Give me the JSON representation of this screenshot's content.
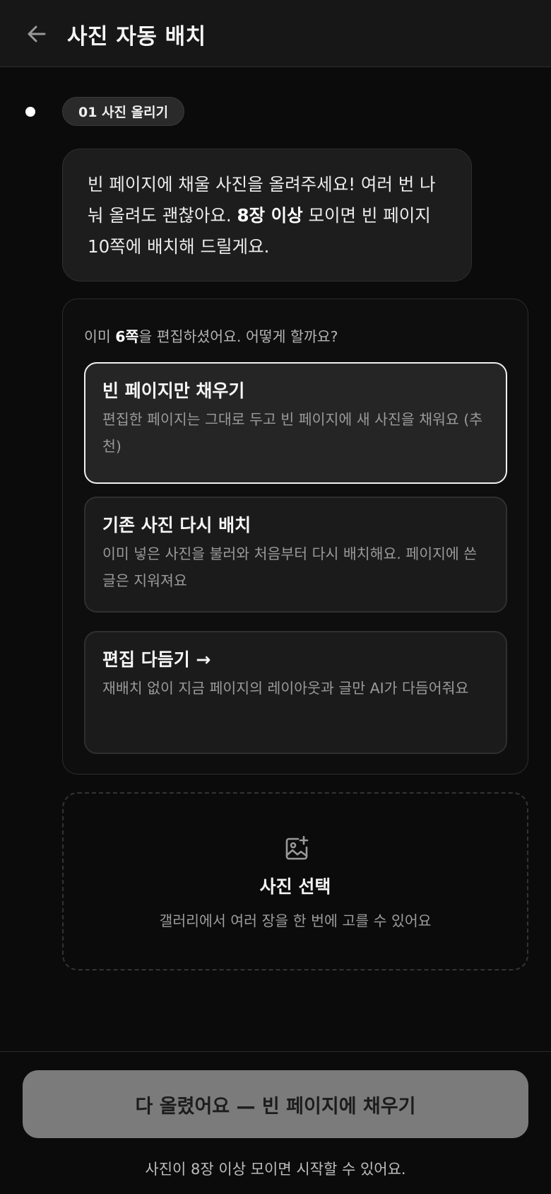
{
  "header": {
    "back_icon": "arrow-left-icon",
    "title": "사진 자동 배치"
  },
  "step": {
    "label": "01 사진 올리기"
  },
  "message": {
    "part1": "빈 페이지에 채울 사진을 올려주세요! 여러 번 나눠 올려도 괜찮아요. ",
    "bold": "8장 이상",
    "part2": " 모이면 빈 페이지 10쪽에 배치해 드릴게요."
  },
  "choice": {
    "question_prefix": "이미 ",
    "question_bold": "6쪽",
    "question_suffix": "을 편집하셨어요. 어떻게 할까요?",
    "options": [
      {
        "title": "빈 페이지만 채우기",
        "description": "편집한 페이지는 그대로 두고 빈 페이지에 새 사진을 채워요 (추천)",
        "selected": true
      },
      {
        "title": "기존 사진 다시 배치",
        "description": "이미 넣은 사진을 불러와 처음부터 다시 배치해요. 페이지에 쓴 글은 지워져요",
        "selected": false
      },
      {
        "title": "편집 다듬기 →",
        "description": "재배치 없이 지금 페이지의 레이아웃과 글만 AI가 다듬어줘요",
        "selected": false
      }
    ]
  },
  "upload": {
    "icon": "image-plus-icon",
    "title": "사진 선택",
    "subtitle": "갤러리에서 여러 장을 한 번에 고를 수 있어요"
  },
  "footer": {
    "cta_label": "다 올렸어요 — 빈 페이지에 채우기",
    "note": "사진이 8장 이상 모이면 시작할 수 있어요."
  }
}
